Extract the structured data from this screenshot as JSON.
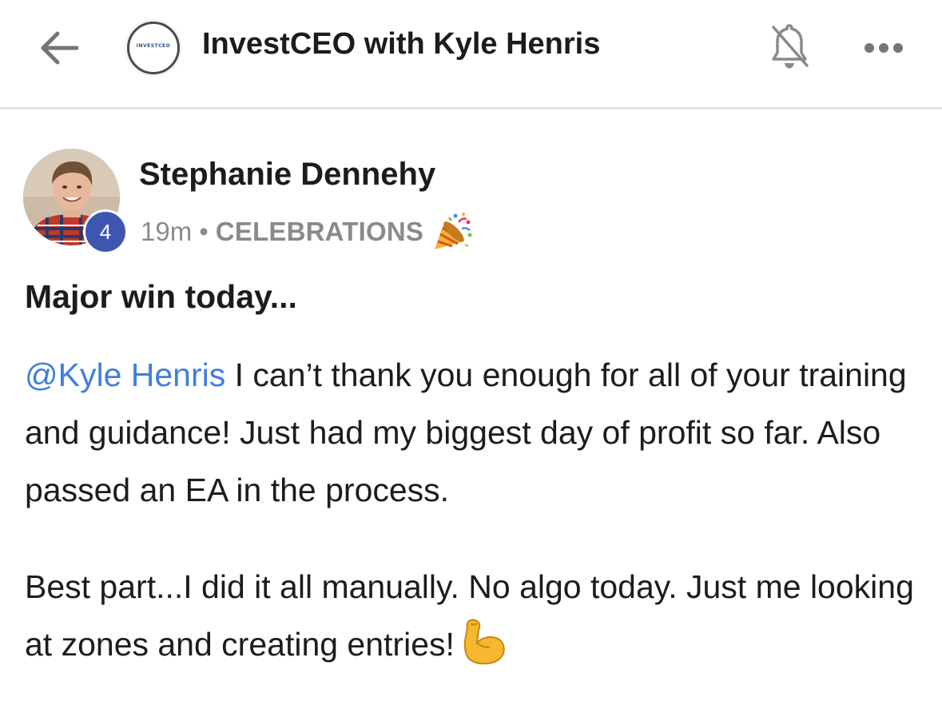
{
  "header": {
    "back_icon": "arrow-left-icon",
    "group_logo_text": "INVESTCEO",
    "title": "InvestCEO with Kyle Henris",
    "notifications_icon": "bell-off-icon",
    "more_icon": "more-horizontal-icon"
  },
  "post": {
    "author": "Stephanie Dennehy",
    "level_badge": "4",
    "time": "19m",
    "separator": "•",
    "category": "CELEBRATIONS",
    "category_icon": "party-popper-icon",
    "title": "Major win today...",
    "mention": "@Kyle Henris",
    "body_line1_rest": " I can’t thank you enough for all of your training and guidance! Just had my biggest day of profit so far. Also passed an EA in the process.",
    "body_para2": "Best part...I did it all manually. No algo today. Just me looking at zones and creating entries!",
    "body_para2_icon": "flexed-biceps-icon"
  },
  "colors": {
    "mention": "#3f7fe0",
    "badge": "#3f56b0",
    "meta": "#8a8a8e"
  }
}
